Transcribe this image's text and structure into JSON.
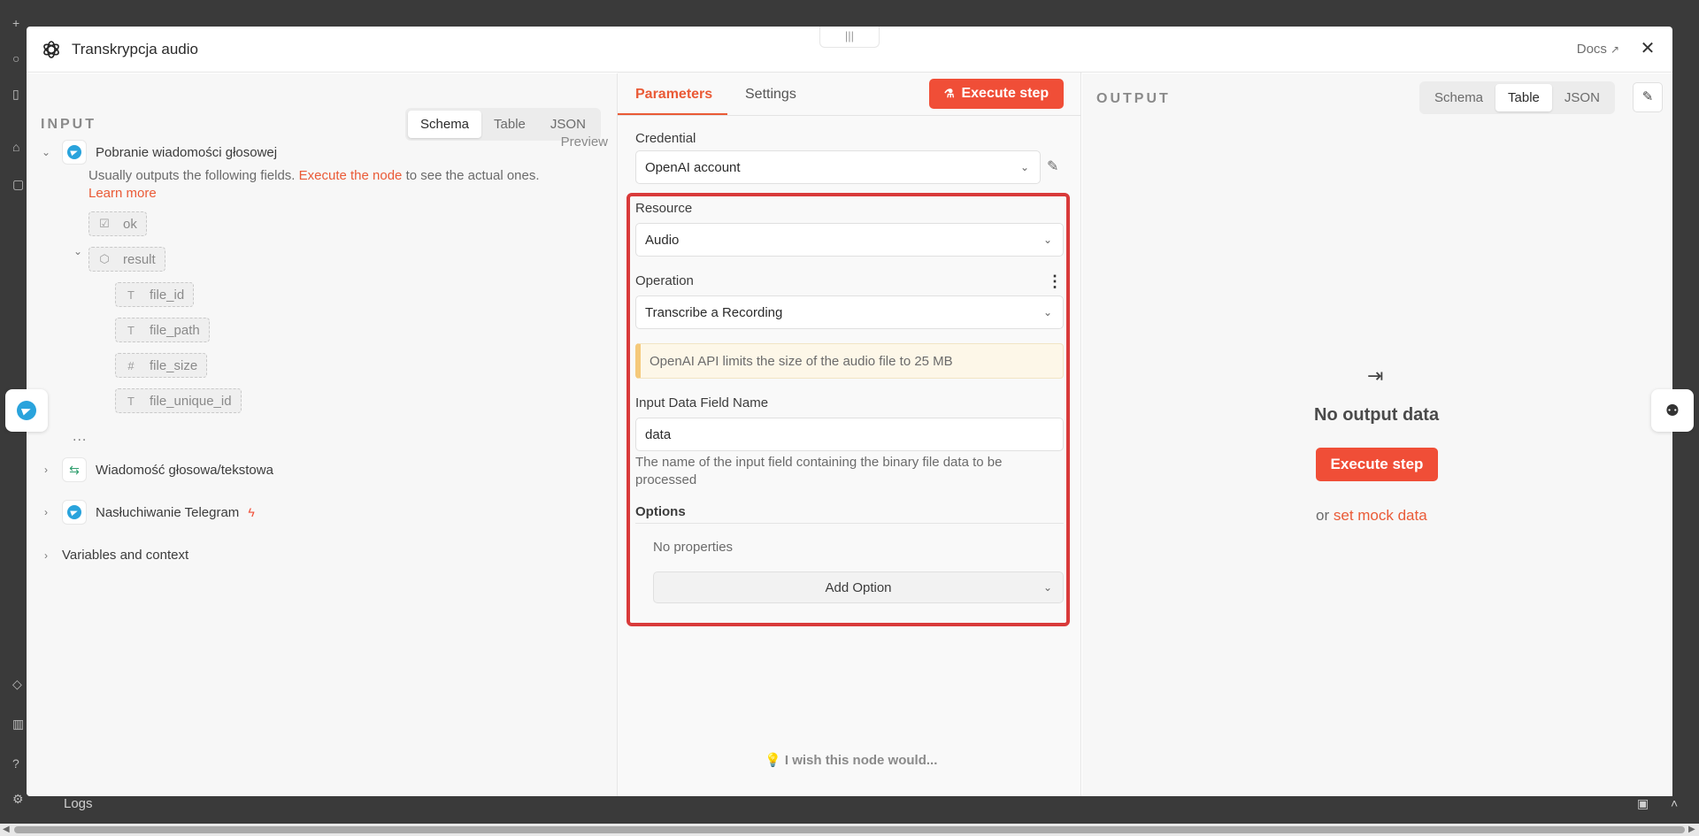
{
  "modal": {
    "title": "Transkrypcja audio",
    "docs_label": "Docs",
    "close_icon": "close-icon"
  },
  "input": {
    "heading": "INPUT",
    "views": [
      "Schema",
      "Table",
      "JSON"
    ],
    "active_view": "Schema",
    "nodes": [
      {
        "label": "Pobranie wiadomości głosowej",
        "icon": "telegram-icon",
        "expanded": true
      },
      {
        "label": "Wiadomość głosowa/tekstowa",
        "icon": "switch-icon",
        "expanded": false
      },
      {
        "label": "Nasłuchiwanie Telegram",
        "icon": "telegram-icon",
        "expanded": false
      }
    ],
    "preview_label": "Preview",
    "hint_prefix": "Usually outputs the following fields.",
    "hint_link": "Execute the node",
    "hint_suffix": "to see the actual ones.",
    "learn_more": "Learn more",
    "fields": [
      {
        "name": "ok",
        "type_icon": "checkbox-icon"
      },
      {
        "name": "result",
        "type_icon": "cube-icon"
      },
      {
        "name": "file_id",
        "type_icon": "text-type-icon"
      },
      {
        "name": "file_path",
        "type_icon": "text-type-icon"
      },
      {
        "name": "file_size",
        "type_icon": "number-type-icon"
      },
      {
        "name": "file_unique_id",
        "type_icon": "text-type-icon"
      }
    ],
    "ellipsis": "...",
    "variables": "Variables and context"
  },
  "params": {
    "tabs": [
      "Parameters",
      "Settings"
    ],
    "active_tab": "Parameters",
    "execute_label": "Execute step",
    "credential_label": "Credential",
    "credential_value": "OpenAI account",
    "resource_label": "Resource",
    "resource_value": "Audio",
    "operation_label": "Operation",
    "operation_value": "Transcribe a Recording",
    "notice": "OpenAI API limits the size of the audio file to 25 MB",
    "input_field_label": "Input Data Field Name",
    "input_field_value": "data",
    "input_field_help": "The name of the input field containing the binary file data to be processed",
    "options_label": "Options",
    "no_properties": "No properties",
    "add_option": "Add Option",
    "wish": "I wish this node would..."
  },
  "output": {
    "heading": "OUTPUT",
    "views": [
      "Schema",
      "Table",
      "JSON"
    ],
    "active_view": "Table",
    "no_output": "No output data",
    "execute_label": "Execute step",
    "or": "or",
    "mock_link": "set mock data"
  },
  "background": {
    "logs_label": "Logs"
  },
  "colors": {
    "accent": "#ea5a36",
    "execute": "#f04e37",
    "highlight": "#d93a3a",
    "telegram": "#29a3dc"
  }
}
